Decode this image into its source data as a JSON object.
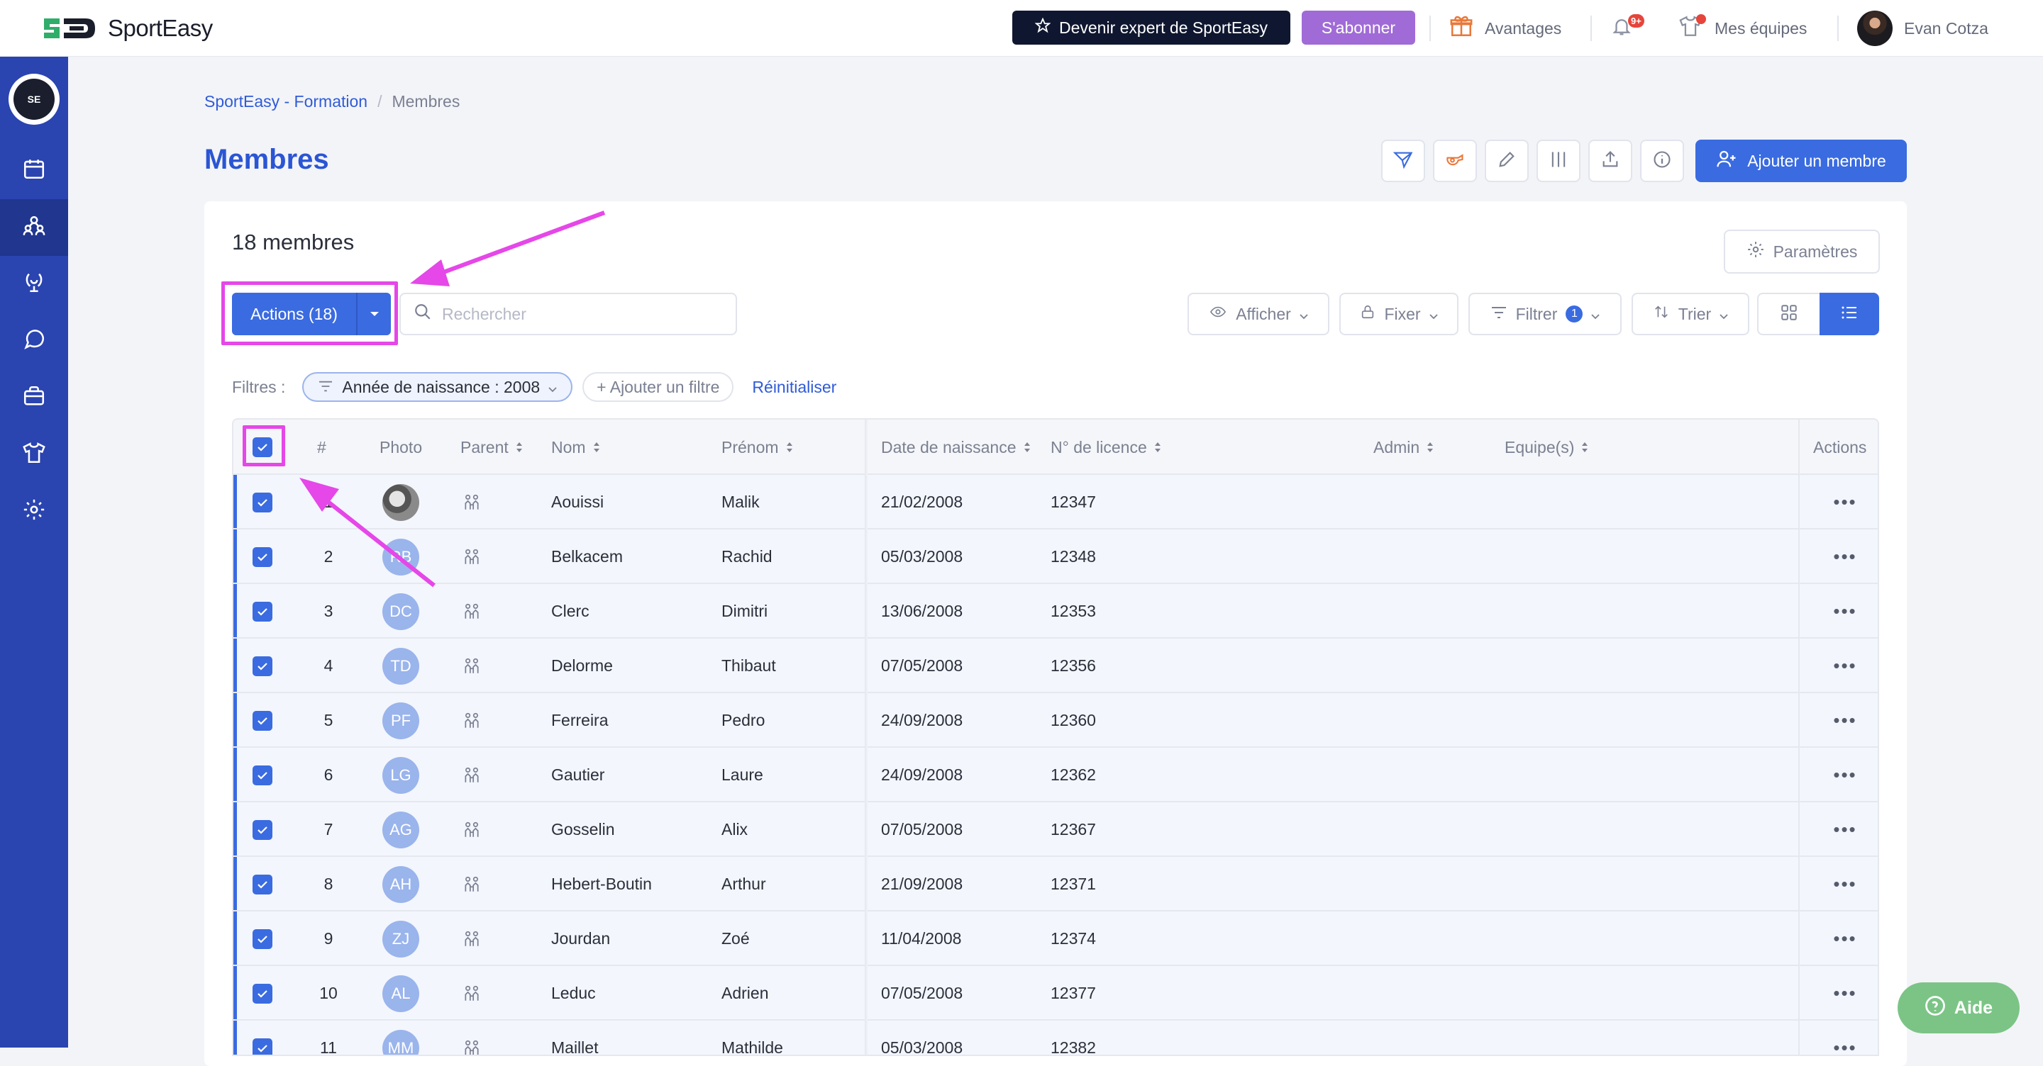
{
  "brand": {
    "name": "SportEasy"
  },
  "topbar": {
    "expert_label": "Devenir expert de SportEasy",
    "subscribe_label": "S'abonner",
    "perks_label": "Avantages",
    "notif_badge": "9+",
    "teams_label": "Mes équipes",
    "user_name": "Evan Cotza"
  },
  "sidebar": {
    "logo_text": "SE",
    "items": [
      "calendar-icon",
      "members-icon",
      "trophy-icon",
      "chat-icon",
      "wallet-icon",
      "shirt-icon",
      "settings-icon"
    ],
    "active": "members-icon"
  },
  "breadcrumb": {
    "team": "SportEasy - Formation",
    "separator": "/",
    "current": "Membres"
  },
  "page": {
    "title": "Membres",
    "add_member_label": "Ajouter un membre"
  },
  "card": {
    "count_label": "18 membres",
    "params_label": "Paramètres",
    "actions_label": "Actions (18)",
    "search_placeholder": "Rechercher",
    "show_label": "Afficher",
    "pin_label": "Fixer",
    "filter_label": "Filtrer",
    "filter_count": "1",
    "sort_label": "Trier"
  },
  "filters": {
    "label": "Filtres :",
    "chip_label": "Année de naissance : 2008",
    "add_label": "+ Ajouter un filtre",
    "reset_label": "Réinitialiser"
  },
  "table": {
    "headers": {
      "num": "#",
      "photo": "Photo",
      "parent": "Parent",
      "nom": "Nom",
      "prenom": "Prénom",
      "dob": "Date de naissance",
      "licence": "N° de licence",
      "admin": "Admin",
      "equipes": "Equipe(s)",
      "actions": "Actions"
    },
    "rows": [
      {
        "n": "1",
        "initials": "",
        "nom": "Aouissi",
        "prenom": "Malik",
        "dob": "21/02/2008",
        "licence": "12347"
      },
      {
        "n": "2",
        "initials": "RB",
        "nom": "Belkacem",
        "prenom": "Rachid",
        "dob": "05/03/2008",
        "licence": "12348"
      },
      {
        "n": "3",
        "initials": "DC",
        "nom": "Clerc",
        "prenom": "Dimitri",
        "dob": "13/06/2008",
        "licence": "12353"
      },
      {
        "n": "4",
        "initials": "TD",
        "nom": "Delorme",
        "prenom": "Thibaut",
        "dob": "07/05/2008",
        "licence": "12356"
      },
      {
        "n": "5",
        "initials": "PF",
        "nom": "Ferreira",
        "prenom": "Pedro",
        "dob": "24/09/2008",
        "licence": "12360"
      },
      {
        "n": "6",
        "initials": "LG",
        "nom": "Gautier",
        "prenom": "Laure",
        "dob": "24/09/2008",
        "licence": "12362"
      },
      {
        "n": "7",
        "initials": "AG",
        "nom": "Gosselin",
        "prenom": "Alix",
        "dob": "07/05/2008",
        "licence": "12367"
      },
      {
        "n": "8",
        "initials": "AH",
        "nom": "Hebert-Boutin",
        "prenom": "Arthur",
        "dob": "21/09/2008",
        "licence": "12371"
      },
      {
        "n": "9",
        "initials": "ZJ",
        "nom": "Jourdan",
        "prenom": "Zoé",
        "dob": "11/04/2008",
        "licence": "12374"
      },
      {
        "n": "10",
        "initials": "AL",
        "nom": "Leduc",
        "prenom": "Adrien",
        "dob": "07/05/2008",
        "licence": "12377"
      },
      {
        "n": "11",
        "initials": "MM",
        "nom": "Maillet",
        "prenom": "Mathilde",
        "dob": "05/03/2008",
        "licence": "12382"
      }
    ]
  },
  "help": {
    "label": "Aide"
  },
  "colors": {
    "primary": "#3a6be0",
    "sidebar": "#2a44b0",
    "highlight": "#e547e8",
    "help": "#7bc486"
  }
}
